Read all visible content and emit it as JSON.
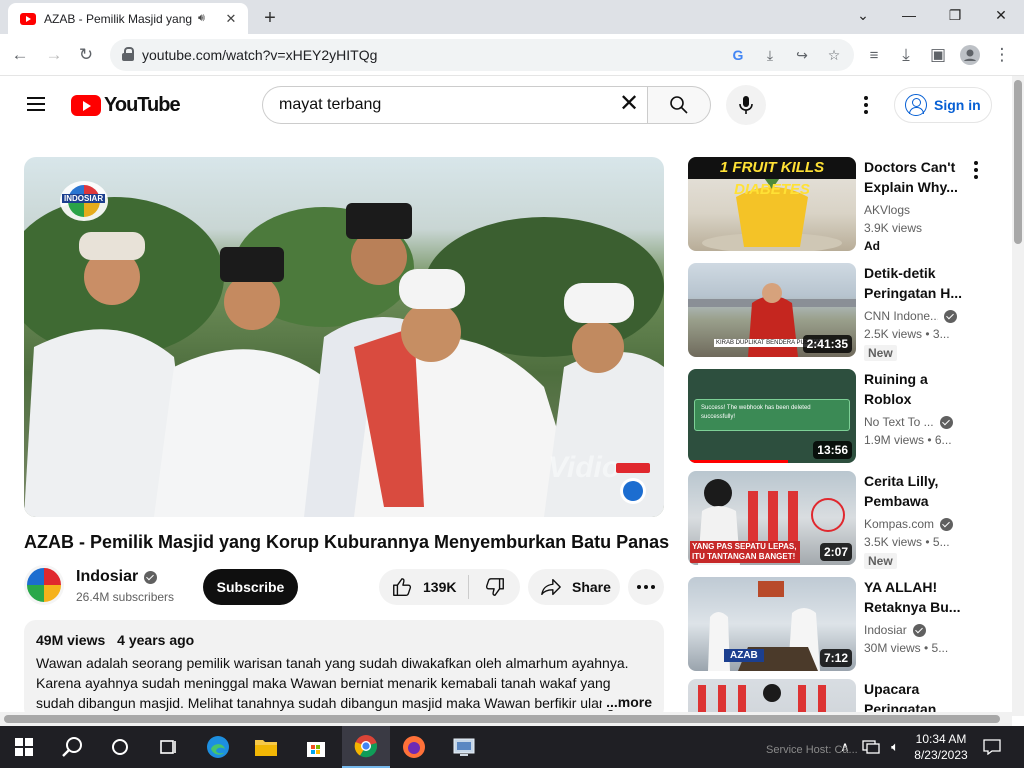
{
  "browser": {
    "tab_title": "AZAB - Pemilik Masjid yang Korup Kuburannya Menyemburkan Batu Panas",
    "new_tab": "+",
    "url": "youtube.com/watch?v=xHEY2yHITQg"
  },
  "masthead": {
    "logo_text": "YouTube",
    "search_value": "mayat terbang",
    "sign_in": "Sign in"
  },
  "video": {
    "watermark": "Vidio",
    "channel_badge": "INDOSIAR",
    "title": "AZAB - Pemilik Masjid yang Korup Kuburannya Menyemburkan Batu Panas",
    "channel": "Indosiar",
    "subscribers": "26.4M subscribers",
    "subscribe_label": "Subscribe",
    "likes": "139K",
    "share_label": "Share"
  },
  "description": {
    "views": "49M views",
    "age": "4 years ago",
    "text": "Wawan adalah seorang pemilik warisan tanah yang sudah diwakafkan oleh almarhum ayahnya. Karena ayahnya sudah meninggal maka Wawan berniat menarik kemabali tanah wakaf yang sudah dibangun masjid. Melihat tanahnya sudah dibangun masjid maka Wawan berfikir ulang untu",
    "more": "...more"
  },
  "recommendations": [
    {
      "thumb_caption": "1 FRUIT KILLS DIABETES",
      "title": "Doctors Can't Explain Why...",
      "channel": "AKVlogs",
      "meta": "3.9K views",
      "badge": "Ad",
      "duration": "",
      "verified": false
    },
    {
      "thumb_caption": "KIRAB DUPLIKAT BENDERA PUSAKA",
      "title": "Detik-detik Peringatan H...",
      "channel": "CNN Indone...",
      "meta": "2.5K views • 3...",
      "badge": "New",
      "duration": "2:41:35",
      "verified": true
    },
    {
      "thumb_caption": "Success! The webhook has been deleted successfully!",
      "title": "Ruining a Roblox Discor...",
      "channel": "No Text To ...",
      "meta": "1.9M views • 6...",
      "badge": "",
      "duration": "13:56",
      "verified": true
    },
    {
      "thumb_caption": "YANG PAS SEPATU LEPAS, ITU TANTANGAN BANGET!",
      "title": "Cerita Lilly, Pembawa Bak...",
      "channel": "Kompas.com",
      "meta": "3.5K views • 5...",
      "badge": "New",
      "duration": "2:07",
      "verified": true
    },
    {
      "thumb_caption": "AZAB",
      "title": "YA ALLAH! Retaknya Bu...",
      "channel": "Indosiar",
      "meta": "30M views • 5...",
      "badge": "",
      "duration": "7:12",
      "verified": true
    },
    {
      "thumb_caption": "",
      "title": "Upacara Peringatan",
      "channel": "",
      "meta": "",
      "badge": "",
      "duration": "",
      "verified": false
    }
  ],
  "taskbar": {
    "time": "10:34 AM",
    "date": "8/23/2023",
    "background_window": "Service Host: Ca..."
  }
}
